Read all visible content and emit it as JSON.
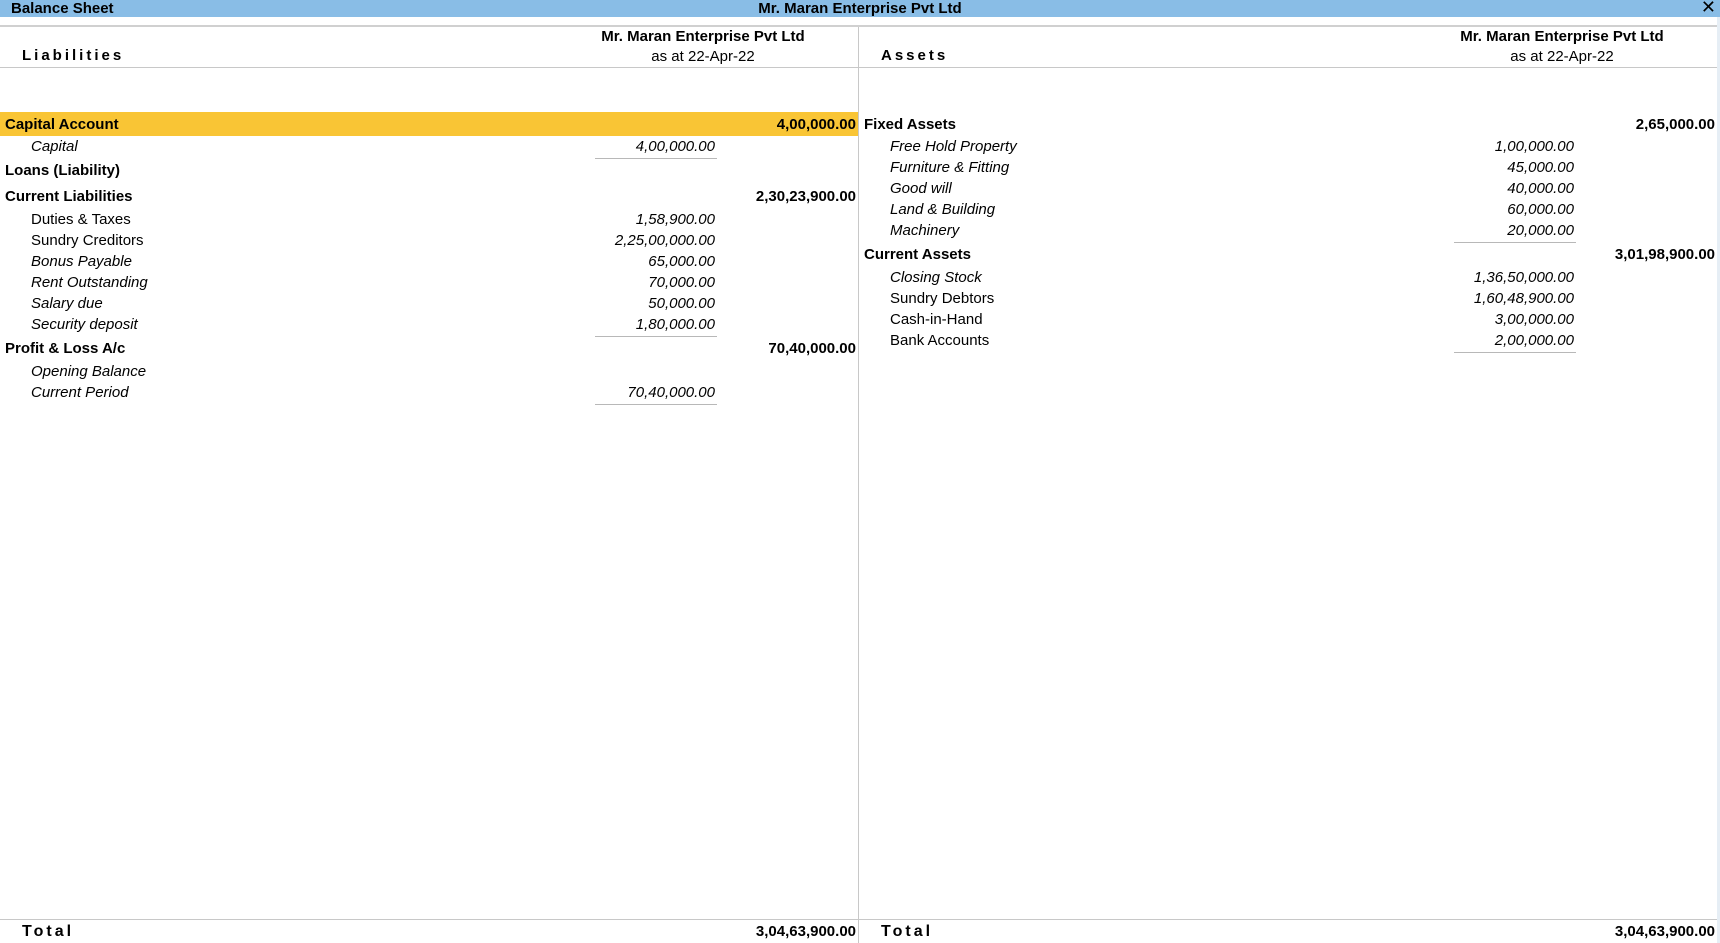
{
  "window": {
    "title": "Balance Sheet",
    "company_title": "Mr. Maran Enterprise  Pvt Ltd",
    "close_icon": "close-icon"
  },
  "colors": {
    "titlebar_bg": "#89bde6",
    "selected_row_bg": "#f9c535"
  },
  "liabilities": {
    "heading": "Liabilities",
    "company": "Mr. Maran Enterprise  Pvt Ltd",
    "date_label": "as at 22-Apr-22",
    "groups": [
      {
        "name": "Capital Account",
        "amount": "4,00,000.00",
        "selected": true,
        "items": [
          {
            "name": "Capital",
            "amount": "4,00,000.00",
            "italic": true
          }
        ]
      },
      {
        "name": "Loans (Liability)",
        "amount": "",
        "items": []
      },
      {
        "name": "Current Liabilities",
        "amount": "2,30,23,900.00",
        "items": [
          {
            "name": "Duties & Taxes",
            "amount": "1,58,900.00",
            "italic": false
          },
          {
            "name": "Sundry Creditors",
            "amount": "2,25,00,000.00",
            "italic": false
          },
          {
            "name": "Bonus Payable",
            "amount": "65,000.00",
            "italic": true
          },
          {
            "name": "Rent Outstanding",
            "amount": "70,000.00",
            "italic": true
          },
          {
            "name": "Salary due",
            "amount": "50,000.00",
            "italic": true
          },
          {
            "name": "Security deposit",
            "amount": "1,80,000.00",
            "italic": true
          }
        ]
      },
      {
        "name": "Profit & Loss A/c",
        "amount": "70,40,000.00",
        "items": [
          {
            "name": "Opening Balance",
            "amount": "",
            "italic": true
          },
          {
            "name": "Current Period",
            "amount": "70,40,000.00",
            "italic": true
          }
        ]
      }
    ],
    "total_label": "Total",
    "total": "3,04,63,900.00"
  },
  "assets": {
    "heading": "Assets",
    "company": "Mr. Maran Enterprise  Pvt Ltd",
    "date_label": "as at 22-Apr-22",
    "groups": [
      {
        "name": "Fixed Assets",
        "amount": "2,65,000.00",
        "items": [
          {
            "name": "Free Hold Property",
            "amount": "1,00,000.00",
            "italic": true
          },
          {
            "name": "Furniture & Fitting",
            "amount": "45,000.00",
            "italic": true
          },
          {
            "name": "Good will",
            "amount": "40,000.00",
            "italic": true
          },
          {
            "name": "Land & Building",
            "amount": "60,000.00",
            "italic": true
          },
          {
            "name": "Machinery",
            "amount": "20,000.00",
            "italic": true
          }
        ]
      },
      {
        "name": "Current Assets",
        "amount": "3,01,98,900.00",
        "items": [
          {
            "name": "Closing Stock",
            "amount": "1,36,50,000.00",
            "italic": true
          },
          {
            "name": "Sundry Debtors",
            "amount": "1,60,48,900.00",
            "italic": false
          },
          {
            "name": "Cash-in-Hand",
            "amount": "3,00,000.00",
            "italic": false
          },
          {
            "name": "Bank Accounts",
            "amount": "2,00,000.00",
            "italic": false
          }
        ]
      }
    ],
    "total_label": "Total",
    "total": "3,04,63,900.00"
  }
}
